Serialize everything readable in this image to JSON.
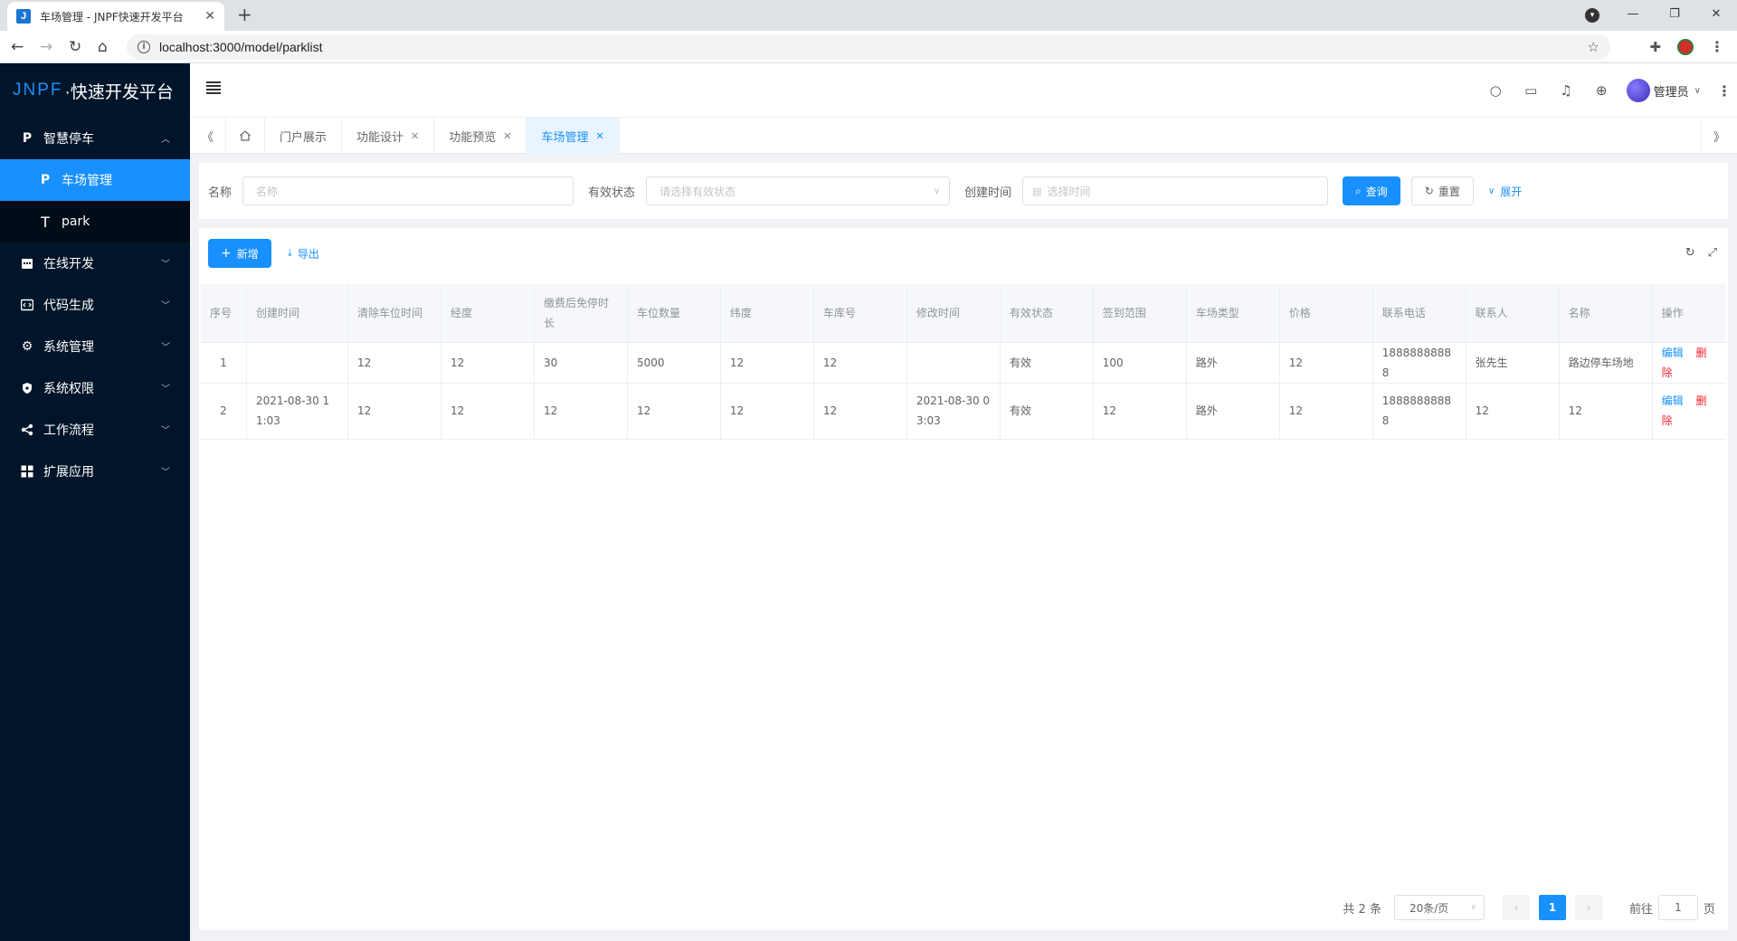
{
  "browser": {
    "tab_title": "车场管理 - JNPF快速开发平台",
    "favicon_letter": "J",
    "url": "localhost:3000/model/parklist"
  },
  "sidebar": {
    "logo_brand": "JNPF",
    "logo_text": "·快速开发平台",
    "groups": [
      {
        "label": "智慧停车",
        "icon": "parking-p-icon",
        "expanded": true,
        "children": [
          {
            "label": "车场管理",
            "icon": "parking-p-icon",
            "active": true
          },
          {
            "label": "park",
            "icon": "text-t-icon",
            "active": false
          }
        ]
      },
      {
        "label": "在线开发",
        "icon": "calendar-icon"
      },
      {
        "label": "代码生成",
        "icon": "code-icon"
      },
      {
        "label": "系统管理",
        "icon": "gear-icon"
      },
      {
        "label": "系统权限",
        "icon": "shield-icon"
      },
      {
        "label": "工作流程",
        "icon": "share-nodes-icon"
      },
      {
        "label": "扩展应用",
        "icon": "grid-icon"
      }
    ]
  },
  "header": {
    "user_name": "管理员"
  },
  "tags": {
    "items": [
      {
        "label": "门户展示",
        "closable": false
      },
      {
        "label": "功能设计",
        "closable": true
      },
      {
        "label": "功能预览",
        "closable": true
      },
      {
        "label": "车场管理",
        "closable": true,
        "active": true
      }
    ]
  },
  "search": {
    "name_label": "名称",
    "name_placeholder": "名称",
    "status_label": "有效状态",
    "status_placeholder": "请选择有效状态",
    "created_label": "创建时间",
    "created_placeholder": "选择时间",
    "query_label": "查询",
    "reset_label": "重置",
    "expand_label": "展开"
  },
  "toolbar": {
    "add_label": "新增",
    "export_label": "导出"
  },
  "table": {
    "columns": [
      "序号",
      "创建时间",
      "清除车位时间",
      "经度",
      "缴费后免停时长",
      "车位数量",
      "纬度",
      "车库号",
      "修改时间",
      "有效状态",
      "签到范围",
      "车场类型",
      "价格",
      "联系电话",
      "联系人",
      "名称",
      "操作"
    ],
    "rows": [
      [
        "1",
        "",
        "12",
        "12",
        "30",
        "5000",
        "12",
        "12",
        "",
        "有效",
        "100",
        "路外",
        "12",
        "18888888888",
        "张先生",
        "路边停车场地"
      ],
      [
        "2",
        "2021-08-30 11:03",
        "12",
        "12",
        "12",
        "12",
        "12",
        "12",
        "2021-08-30 03:03",
        "有效",
        "12",
        "路外",
        "12",
        "18888888888",
        "12",
        "12"
      ]
    ],
    "edit_label": "编辑",
    "delete_label": "删除"
  },
  "pagination": {
    "total_text": "共 2 条",
    "page_size": "20条/页",
    "current_page": "1",
    "goto_label": "前往",
    "goto_value": "1",
    "page_suffix": "页"
  },
  "colors": {
    "primary": "#1890ff",
    "sidebar_bg": "#001529",
    "danger": "#f5222d"
  }
}
